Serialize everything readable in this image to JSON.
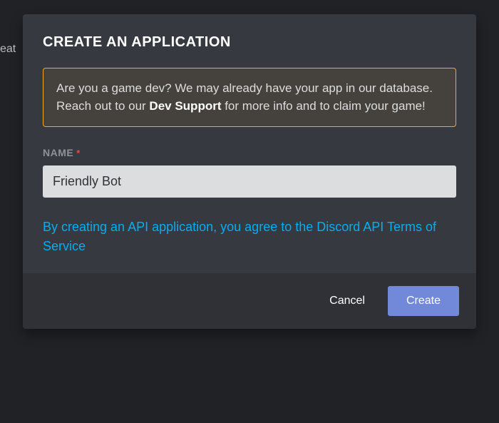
{
  "background": {
    "fragment": "eat"
  },
  "modal": {
    "title": "CREATE AN APPLICATION",
    "notice": {
      "prefix": "Are you a game dev? We may already have your app in our database. Reach out to our ",
      "bold": "Dev Support",
      "suffix": " for more info and to claim your game!"
    },
    "nameField": {
      "label": "NAME",
      "required": "*",
      "value": "Friendly Bot"
    },
    "tos": "By creating an API application, you agree to the Discord API Terms of Service",
    "buttons": {
      "cancel": "Cancel",
      "create": "Create"
    }
  }
}
